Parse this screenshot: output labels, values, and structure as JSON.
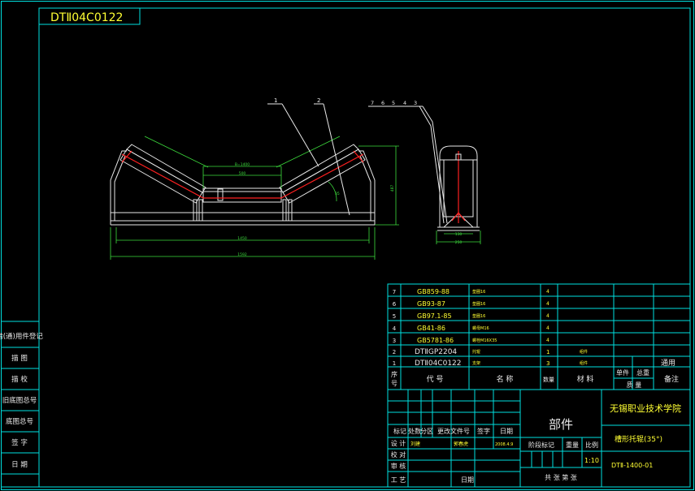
{
  "drawing_code_top": "DTⅡ04C0122",
  "views": {
    "front": {
      "balloons": [
        "1",
        "2"
      ],
      "dims": {
        "belt_width": "B=1400",
        "inner_gap": "500",
        "overall": "1592",
        "span": "1450",
        "height": "487",
        "angle": "35"
      }
    },
    "side": {
      "balloons": [
        "7",
        "6",
        "5",
        "4",
        "3"
      ],
      "dims": {
        "inner": "130",
        "outer": "250"
      }
    }
  },
  "parts": [
    {
      "no": "7",
      "code": "GB859-88",
      "name": "垫圈16",
      "qty": "4",
      "material": "",
      "remark": ""
    },
    {
      "no": "6",
      "code": "GB93-87",
      "name": "垫圈16",
      "qty": "4",
      "material": "",
      "remark": ""
    },
    {
      "no": "5",
      "code": "GB97.1-85",
      "name": "垫圈16",
      "qty": "4",
      "material": "",
      "remark": ""
    },
    {
      "no": "4",
      "code": "GB41-86",
      "name": "螺母M16",
      "qty": "4",
      "material": "",
      "remark": ""
    },
    {
      "no": "3",
      "code": "GB5781-86",
      "name": "螺栓M16X35",
      "qty": "4",
      "material": "",
      "remark": ""
    },
    {
      "no": "2",
      "code": "DTⅡGP2204",
      "name": "托辊",
      "qty": "1",
      "material": "组件",
      "remark": ""
    },
    {
      "no": "1",
      "code": "DTⅡ04C0122",
      "name": "支架",
      "qty": "3",
      "material": "组件",
      "remark": "通用"
    }
  ],
  "parts_header": {
    "no": "序号",
    "code": "代 号",
    "name": "名 称",
    "qty": "数量",
    "material": "材 料",
    "unit_weight": "单件",
    "total_weight": "总重",
    "mass": "质 量",
    "remark": "备注"
  },
  "left_strip": [
    "借(通)用件登记",
    "描 图",
    "描 校",
    "旧底图总号",
    "底图总号",
    "签 字",
    "日 期"
  ],
  "title_block": {
    "rev_header": [
      "标记",
      "处数",
      "分区",
      "更改文件号",
      "签字",
      "日期"
    ],
    "roles": [
      "设 计",
      "校 对",
      "审 核",
      "工 艺"
    ],
    "designer": "刘建",
    "checker": "郭春虎",
    "date_1": "2008.4.9",
    "approve_date": "日期",
    "category": "部件",
    "stage_label": "阶段标记",
    "weight_label": "重量",
    "scale_label": "比例",
    "scale": "1:10",
    "sheets_label": "共 张 第 张",
    "school": "无锡职业技术学院",
    "drawing_title": "槽形托辊(35°)",
    "drawing_no": "DTⅡ-1400-01"
  }
}
